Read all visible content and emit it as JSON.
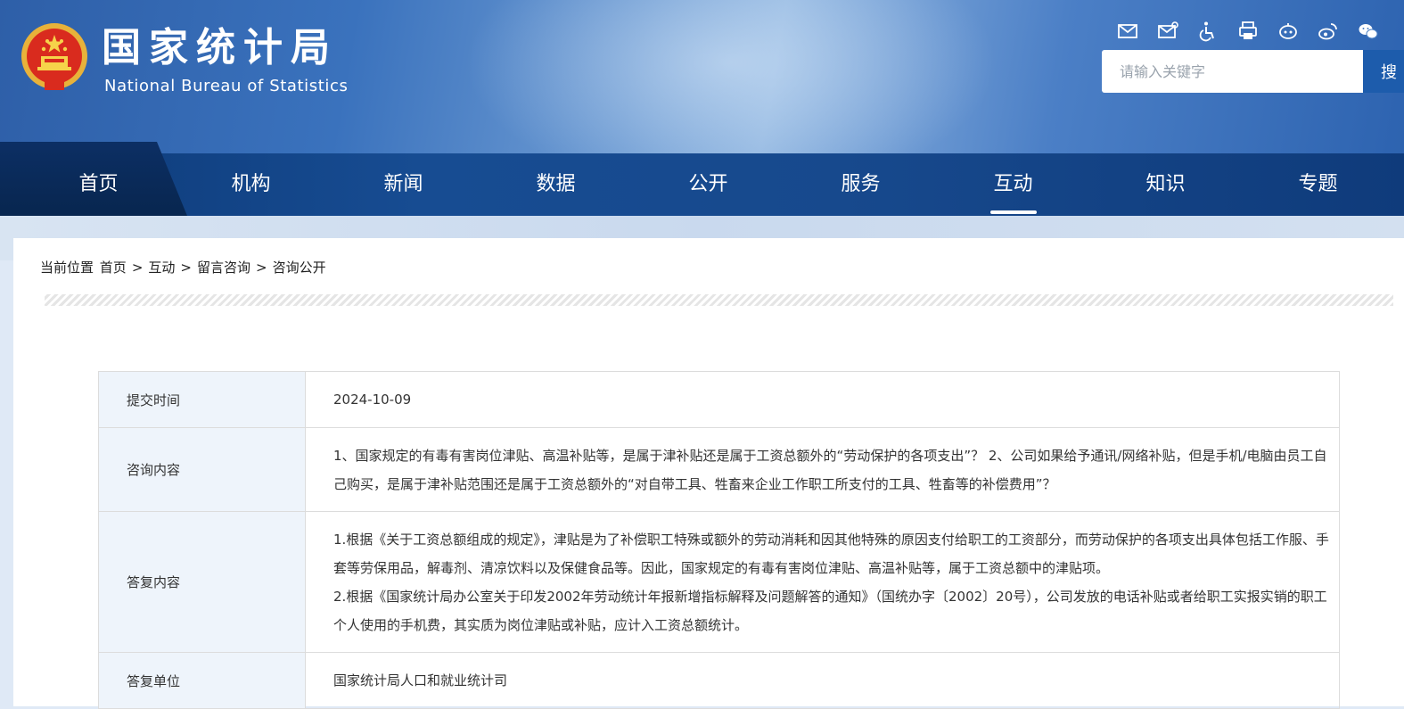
{
  "header": {
    "title_cn": "国家统计局",
    "title_en": "National Bureau of Statistics",
    "search_placeholder": "请输入关键字",
    "search_button": "搜",
    "tools": [
      "mail-icon",
      "mailbox-icon",
      "accessibility-icon",
      "print-icon",
      "robot-icon",
      "weibo-icon",
      "wechat-icon"
    ]
  },
  "nav": {
    "items": [
      "首页",
      "机构",
      "新闻",
      "数据",
      "公开",
      "服务",
      "互动",
      "知识",
      "专题"
    ],
    "active": "互动"
  },
  "breadcrumb": {
    "prefix": "当前位置",
    "items": [
      "首页",
      "互动",
      "留言咨询",
      "咨询公开"
    ],
    "separator": ">"
  },
  "record": {
    "submit_label": "提交时间",
    "submit_value": "2024-10-09",
    "question_label": "咨询内容",
    "question_value": "1、国家规定的有毒有害岗位津贴、高温补贴等，是属于津补贴还是属于工资总额外的“劳动保护的各项支出”？ 2、公司如果给予通讯/网络补贴，但是手机/电脑由员工自己购买，是属于津补贴范围还是属于工资总额外的“对自带工具、牲畜来企业工作职工所支付的工具、牲畜等的补偿费用”？",
    "answer_label": "答复内容",
    "answer_p1": "1.根据《关于工资总额组成的规定》，津贴是为了补偿职工特殊或额外的劳动消耗和因其他特殊的原因支付给职工的工资部分，而劳动保护的各项支出具体包括工作服、手套等劳保用品，解毒剂、清凉饮料以及保健食品等。因此，国家规定的有毒有害岗位津贴、高温补贴等，属于工资总额中的津贴项。",
    "answer_p2": "2.根据《国家统计局办公室关于印发2002年劳动统计年报新增指标解释及问题解答的通知》（国统办字〔2002〕20号），公司发放的电话补贴或者给职工实报实销的职工个人使用的手机费，其实质为岗位津贴或补贴，应计入工资总额统计。",
    "unit_label": "答复单位",
    "unit_value": "国家统计局人口和就业统计司"
  }
}
